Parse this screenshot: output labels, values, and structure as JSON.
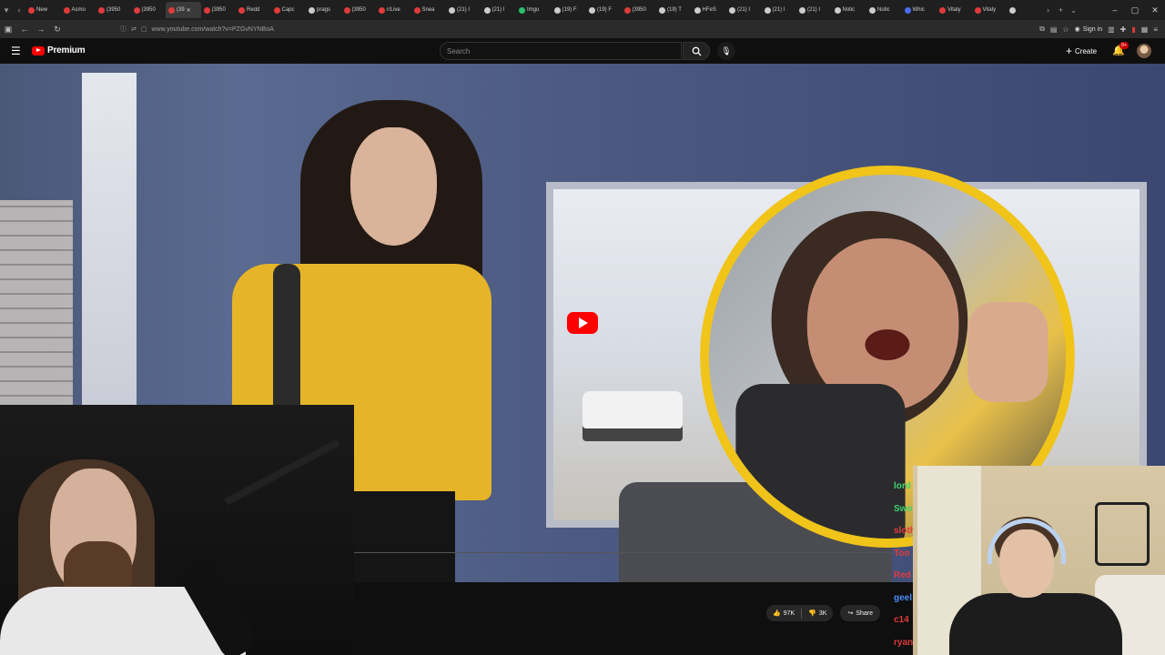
{
  "browser": {
    "tabs": [
      {
        "label": "New",
        "color": "#e03b3b"
      },
      {
        "label": "Asmo",
        "color": "#e03b3b"
      },
      {
        "label": "(3950",
        "color": "#e03b3b"
      },
      {
        "label": "(3950",
        "color": "#e03b3b"
      },
      {
        "label": "(39",
        "color": "#e03b3b",
        "active": true
      },
      {
        "label": "(3950",
        "color": "#e03b3b"
      },
      {
        "label": "Redd",
        "color": "#e03b3b"
      },
      {
        "label": "Capc",
        "color": "#e03b3b"
      },
      {
        "label": "prags",
        "color": "#cccccc"
      },
      {
        "label": "(3950",
        "color": "#e03b3b"
      },
      {
        "label": "r/Live",
        "color": "#e03b3b"
      },
      {
        "label": "Snea",
        "color": "#e03b3b"
      },
      {
        "label": "(21) I",
        "color": "#cccccc"
      },
      {
        "label": "(21) I",
        "color": "#cccccc"
      },
      {
        "label": "Imgu",
        "color": "#2bbf6b"
      },
      {
        "label": "(19) F",
        "color": "#cccccc"
      },
      {
        "label": "(19) F",
        "color": "#cccccc"
      },
      {
        "label": "(3950",
        "color": "#e03b3b"
      },
      {
        "label": "(19) T",
        "color": "#cccccc"
      },
      {
        "label": "HFeS",
        "color": "#cccccc"
      },
      {
        "label": "(21) I",
        "color": "#cccccc"
      },
      {
        "label": "(21) I",
        "color": "#cccccc"
      },
      {
        "label": "(21) I",
        "color": "#cccccc"
      },
      {
        "label": "Notic",
        "color": "#cccccc"
      },
      {
        "label": "Notic",
        "color": "#cccccc"
      },
      {
        "label": "Whic",
        "color": "#4a6cf7"
      },
      {
        "label": "Vitaly",
        "color": "#e03b3b"
      },
      {
        "label": "Vitaly",
        "color": "#e03b3b"
      },
      {
        "label": "",
        "color": "#cccccc"
      }
    ],
    "url": "www.youtube.com/watch?v=PZGvNYNBoA",
    "sign_in": "Sign in"
  },
  "youtube": {
    "logo_text": "Premium",
    "search_placeholder": "Search",
    "create_label": "Create",
    "notification_badge": "9+",
    "likes": "97K",
    "dislikes": "3K",
    "share_label": "Share"
  },
  "chat": {
    "names": [
      {
        "text": "lord",
        "color": "#3cd26c"
      },
      {
        "text": "Swo",
        "color": "#3cd26c"
      },
      {
        "text": "sloth",
        "color": "#e03b3b"
      },
      {
        "text": "Too",
        "color": "#e03b3b"
      },
      {
        "text": "Red",
        "color": "#e03b3b"
      },
      {
        "text": "geel",
        "color": "#4a8cf7"
      },
      {
        "text": "c14",
        "color": "#e03b3b"
      },
      {
        "text": "ryan",
        "color": "#e03b3b"
      }
    ]
  },
  "colors": {
    "youtube_red": "#ff0000",
    "inset_border": "#f0c419"
  }
}
